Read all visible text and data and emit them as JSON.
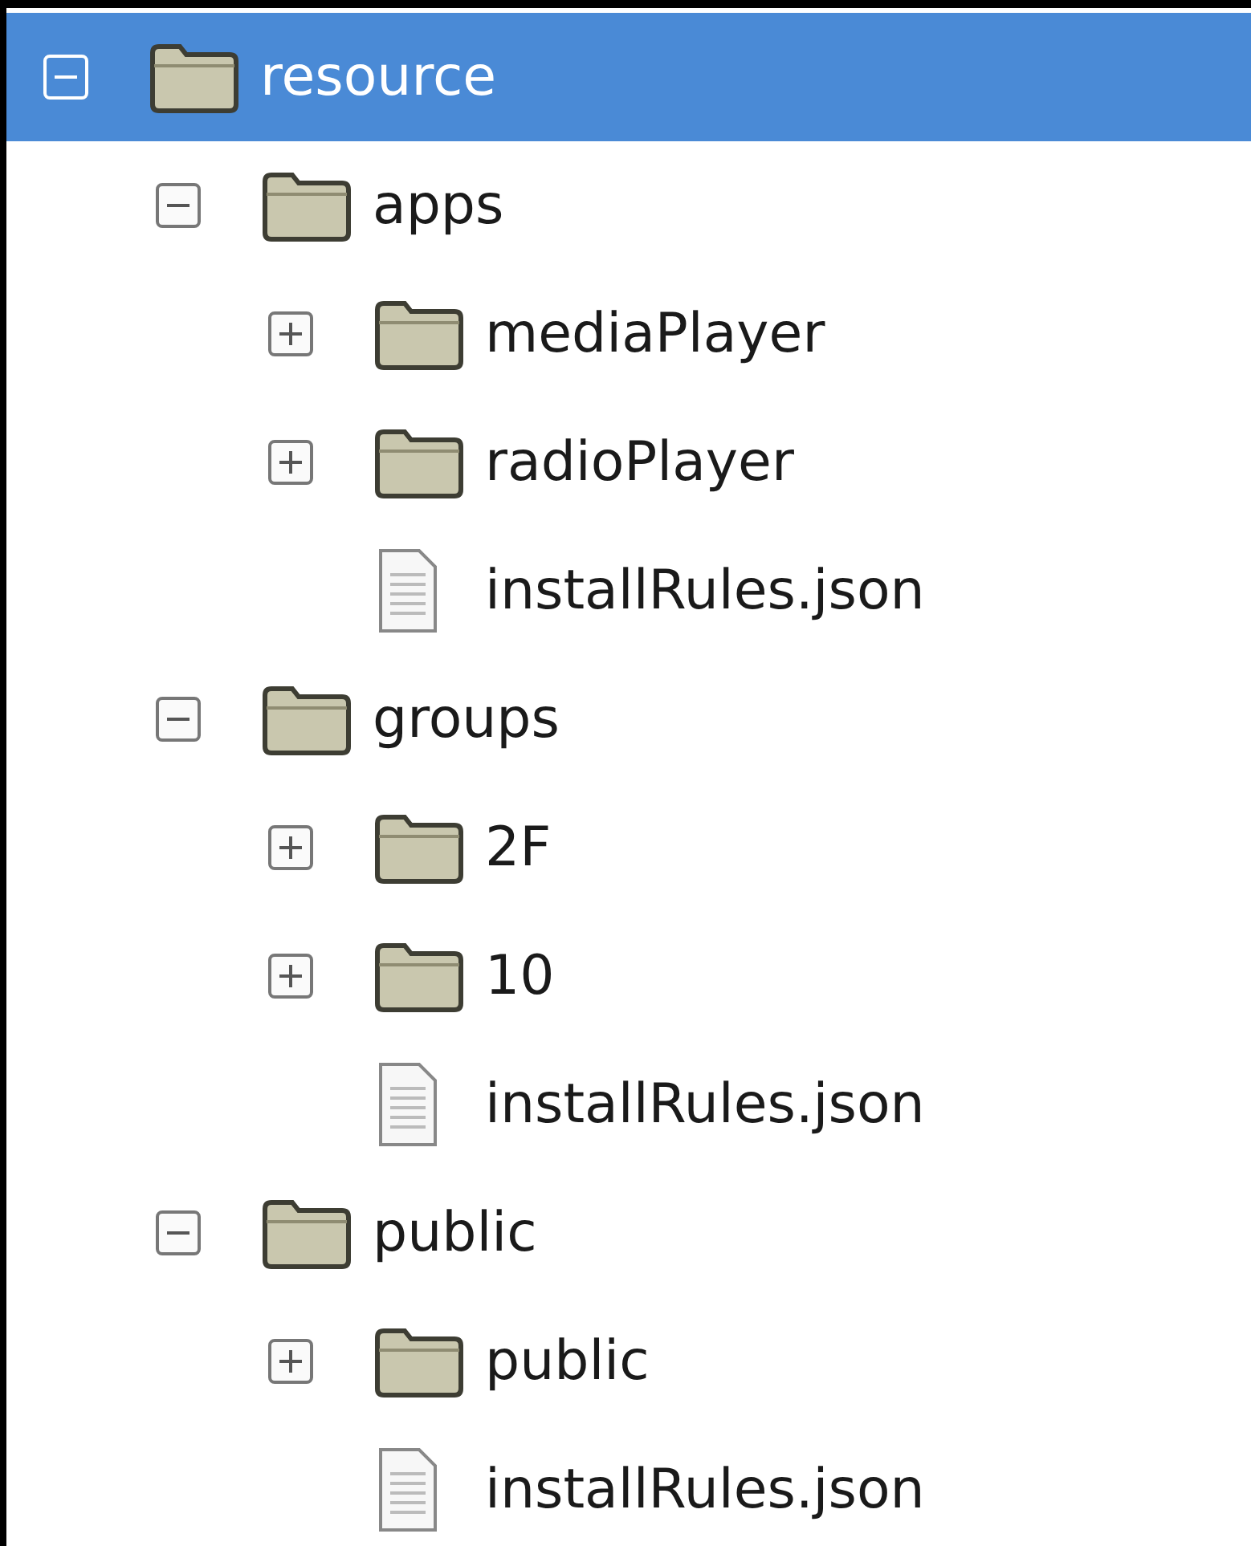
{
  "tree": [
    {
      "kind": "folder",
      "label": "resource",
      "expanded": true,
      "selected": true,
      "children": [
        {
          "kind": "folder",
          "label": "apps",
          "expanded": true,
          "selected": false,
          "children": [
            {
              "kind": "folder",
              "label": "mediaPlayer",
              "expanded": false,
              "selected": false
            },
            {
              "kind": "folder",
              "label": "radioPlayer",
              "expanded": false,
              "selected": false
            },
            {
              "kind": "file",
              "label": "installRules.json",
              "selected": false
            }
          ]
        },
        {
          "kind": "folder",
          "label": "groups",
          "expanded": true,
          "selected": false,
          "children": [
            {
              "kind": "folder",
              "label": "2F",
              "expanded": false,
              "selected": false
            },
            {
              "kind": "folder",
              "label": "10",
              "expanded": false,
              "selected": false
            },
            {
              "kind": "file",
              "label": "installRules.json",
              "selected": false
            }
          ]
        },
        {
          "kind": "folder",
          "label": "public",
          "expanded": true,
          "selected": false,
          "children": [
            {
              "kind": "folder",
              "label": "public",
              "expanded": false,
              "selected": false
            },
            {
              "kind": "file",
              "label": "installRules.json",
              "selected": false
            }
          ]
        }
      ]
    }
  ]
}
